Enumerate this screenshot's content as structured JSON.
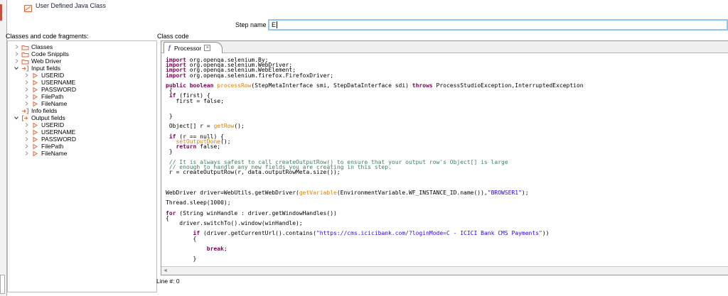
{
  "window": {
    "title": "User Defined Java Class"
  },
  "step": {
    "label": "Step name",
    "value": "E"
  },
  "left_panel": {
    "heading": "Classes and code fragments:",
    "tree": [
      {
        "label": "Classes",
        "icon": "folder",
        "expander": "collapsed",
        "level": 0
      },
      {
        "label": "Code Snippits",
        "icon": "folder",
        "expander": "collapsed",
        "level": 0
      },
      {
        "label": "Web Driver",
        "icon": "folder",
        "expander": "collapsed",
        "level": 0
      },
      {
        "label": "Input fields",
        "icon": "input-fields",
        "expander": "expanded",
        "level": 0
      },
      {
        "label": "USERID",
        "icon": "field",
        "expander": "collapsed",
        "level": 1
      },
      {
        "label": "USERNAME",
        "icon": "field",
        "expander": "collapsed",
        "level": 1
      },
      {
        "label": "PASSWORD",
        "icon": "field",
        "expander": "collapsed",
        "level": 1
      },
      {
        "label": "FilePath",
        "icon": "field",
        "expander": "collapsed",
        "level": 1
      },
      {
        "label": "FileName",
        "icon": "field",
        "expander": "collapsed",
        "level": 1
      },
      {
        "label": "Info fields",
        "icon": "input-fields",
        "expander": "none",
        "level": 0
      },
      {
        "label": "Output fields",
        "icon": "output-fields",
        "expander": "expanded",
        "level": 0
      },
      {
        "label": "USERID",
        "icon": "field",
        "expander": "collapsed",
        "level": 1
      },
      {
        "label": "USERNAME",
        "icon": "field",
        "expander": "collapsed",
        "level": 1
      },
      {
        "label": "PASSWORD",
        "icon": "field",
        "expander": "collapsed",
        "level": 1
      },
      {
        "label": "FilePath",
        "icon": "field",
        "expander": "collapsed",
        "level": 1
      },
      {
        "label": "FileName",
        "icon": "field",
        "expander": "collapsed",
        "level": 1
      }
    ]
  },
  "code_panel": {
    "heading": "Class code",
    "tab": {
      "label": "Processor",
      "close_glyph": "×",
      "icon": "script-icon"
    },
    "status_line": "Line #: 0",
    "code_lines": [
      [
        {
          "c": "kw",
          "t": "import"
        },
        {
          "c": "pl",
          "t": " org.openqa.selenium.By;"
        }
      ],
      [
        {
          "c": "kw",
          "t": "import"
        },
        {
          "c": "pl",
          "t": " org.openqa.selenium.WebDriver;"
        }
      ],
      [
        {
          "c": "kw",
          "t": "import"
        },
        {
          "c": "pl",
          "t": " org.openqa.selenium.WebElement;"
        }
      ],
      [
        {
          "c": "kw",
          "t": "import"
        },
        {
          "c": "pl",
          "t": " org.openqa.selenium.firefox.FirefoxDriver;"
        }
      ],
      [],
      [
        {
          "c": "kw",
          "t": "public boolean "
        },
        {
          "c": "fn",
          "t": "processRow"
        },
        {
          "c": "pl",
          "t": "(StepMetaInterface smi, StepDataInterface sdi) "
        },
        {
          "c": "kw",
          "t": "throws"
        },
        {
          "c": "pl",
          "t": " ProcessStudioException,InterruptedException"
        }
      ],
      [
        {
          "c": "pl",
          "t": " {"
        }
      ],
      [
        {
          "c": "pl",
          "t": " "
        },
        {
          "c": "kw",
          "t": "if"
        },
        {
          "c": "pl",
          "t": " (first) {"
        }
      ],
      [
        {
          "c": "pl",
          "t": "   first = false;"
        }
      ],
      [],
      [],
      [
        {
          "c": "pl",
          "t": " }"
        }
      ],
      [],
      [
        {
          "c": "pl",
          "t": " Object[] r = "
        },
        {
          "c": "fn",
          "t": "getRow"
        },
        {
          "c": "pl",
          "t": "();"
        }
      ],
      [],
      [
        {
          "c": "pl",
          "t": " "
        },
        {
          "c": "kw",
          "t": "if"
        },
        {
          "c": "pl",
          "t": " (r == null) {"
        }
      ],
      [
        {
          "c": "pl",
          "t": "   "
        },
        {
          "c": "fn",
          "t": "setOutputDone"
        },
        {
          "c": "pl",
          "t": "();"
        }
      ],
      [
        {
          "c": "pl",
          "t": "   "
        },
        {
          "c": "kw",
          "t": "return"
        },
        {
          "c": "pl",
          "t": " false;"
        }
      ],
      [
        {
          "c": "pl",
          "t": " }"
        }
      ],
      [],
      [
        {
          "c": "com",
          "t": " // It is always safest to call createOutputRow() to ensure that your output row's Object[] is large"
        }
      ],
      [
        {
          "c": "com",
          "t": " // enough to handle any new fields you are creating in this step."
        }
      ],
      [
        {
          "c": "pl",
          "t": " r = createOutputRow(r, data.outputRowMeta.size());"
        }
      ],
      [],
      [],
      [],
      [
        {
          "c": "pl",
          "t": "WebDriver driver=WebUtils.getWebDriver("
        },
        {
          "c": "fn",
          "t": "getVariable"
        },
        {
          "c": "pl",
          "t": "(EnvironmentVariable.WF_INSTANCE_ID.name()),"
        },
        {
          "c": "str",
          "t": "\"BROWSER1\""
        },
        {
          "c": "pl",
          "t": ");"
        }
      ],
      [],
      [
        {
          "c": "pl",
          "t": "Thread.sleep(1000);"
        }
      ],
      [],
      [
        {
          "c": "kw",
          "t": "for"
        },
        {
          "c": "pl",
          "t": " (String winHandle : driver.getWindowHandles())"
        }
      ],
      [
        {
          "c": "pl",
          "t": "{"
        }
      ],
      [
        {
          "c": "pl",
          "t": "    driver.switchTo().window(winHandle);"
        }
      ],
      [],
      [
        {
          "c": "pl",
          "t": "        "
        },
        {
          "c": "kw",
          "t": "if"
        },
        {
          "c": "pl",
          "t": " (driver.getCurrentUrl().contains("
        },
        {
          "c": "str",
          "t": "\"https://cms.icicibank.com/?loginMode=C - ICICI Bank CMS Payments\""
        },
        {
          "c": "pl",
          "t": "))"
        }
      ],
      [
        {
          "c": "pl",
          "t": "        {"
        }
      ],
      [],
      [
        {
          "c": "pl",
          "t": "            "
        },
        {
          "c": "kw",
          "t": "break"
        },
        {
          "c": "pl",
          "t": ";"
        }
      ],
      [],
      [
        {
          "c": "pl",
          "t": "        }"
        }
      ]
    ]
  },
  "colors": {
    "keyword": "#7f0055",
    "function_call": "#e08000",
    "string": "#2a00ff",
    "comment": "#3f7f5f",
    "accent_orange": "#d96c3a",
    "focus_border": "#90c5ee"
  }
}
